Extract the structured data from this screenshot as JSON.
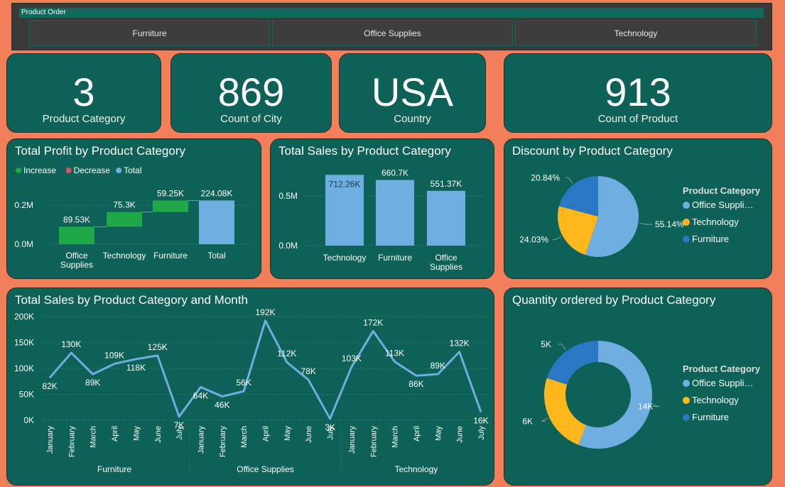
{
  "slicer": {
    "title": "Product Order",
    "options": [
      "Furniture",
      "Office Supplies",
      "Technology"
    ]
  },
  "kpis": [
    {
      "value": "3",
      "label": "Product Category"
    },
    {
      "value": "869",
      "label": "Count of City"
    },
    {
      "value": "USA",
      "label": "Country"
    },
    {
      "value": "913",
      "label": "Count of Product"
    }
  ],
  "colors": {
    "background": "#f07f5a",
    "card": "#0d6157",
    "increase": "#1fa847",
    "decrease": "#e0505a",
    "total": "#6faee0",
    "office_supplies": "#6faee0",
    "technology": "#ffb81c",
    "furniture": "#2a77c4"
  },
  "chart_data": [
    {
      "id": "profit",
      "type": "waterfall",
      "title": "Total Profit by Product Category",
      "legend": [
        {
          "label": "Increase",
          "color": "#1fa847"
        },
        {
          "label": "Decrease",
          "color": "#e0505a"
        },
        {
          "label": "Total",
          "color": "#6faee0"
        }
      ],
      "categories": [
        "Office Supplies",
        "Technology",
        "Furniture",
        "Total"
      ],
      "values": [
        89530,
        75300,
        59250,
        224080
      ],
      "labels": [
        "89.53K",
        "75.3K",
        "59.25K",
        "224.08K"
      ],
      "yticks": [
        "0.0M",
        "0.2M"
      ],
      "ytick_values": [
        0,
        200000
      ],
      "ylim": [
        0,
        260000
      ]
    },
    {
      "id": "sales",
      "type": "bar",
      "title": "Total Sales by Product Category",
      "categories": [
        "Technology",
        "Furniture",
        "Office Supplies"
      ],
      "values": [
        712260,
        660700,
        551370
      ],
      "labels": [
        "712.26K",
        "660.7K",
        "551.37K"
      ],
      "yticks": [
        "0.0M",
        "0.5M"
      ],
      "ytick_values": [
        0,
        500000
      ],
      "ylim": [
        0,
        750000
      ]
    },
    {
      "id": "discount",
      "type": "pie",
      "title": "Discount by Product Category",
      "legend_title": "Product Category",
      "slices": [
        {
          "name": "Office Suppli…",
          "value": 55.14,
          "label": "55.14%",
          "color": "#6faee0"
        },
        {
          "name": "Technology",
          "value": 24.03,
          "label": "24.03%",
          "color": "#ffb81c"
        },
        {
          "name": "Furniture",
          "value": 20.84,
          "label": "20.84%",
          "color": "#2a77c4"
        }
      ]
    },
    {
      "id": "monthly",
      "type": "line",
      "title": "Total Sales by Product Category and Month",
      "groups": [
        "Furniture",
        "Office Supplies",
        "Technology"
      ],
      "months": [
        "January",
        "February",
        "March",
        "April",
        "May",
        "June",
        "July"
      ],
      "values": [
        82,
        130,
        89,
        109,
        118,
        125,
        7,
        64,
        46,
        56,
        192,
        112,
        78,
        3,
        103,
        172,
        113,
        86,
        89,
        132,
        16
      ],
      "labels": [
        "82K",
        "130K",
        "89K",
        "109K",
        "118K",
        "125K",
        "7K",
        "64K",
        "46K",
        "56K",
        "192K",
        "112K",
        "78K",
        "3K",
        "103K",
        "172K",
        "113K",
        "86K",
        "89K",
        "132K",
        "16K"
      ],
      "yticks": [
        "0K",
        "50K",
        "100K",
        "150K",
        "200K"
      ],
      "ytick_values": [
        0,
        50,
        100,
        150,
        200
      ],
      "ylim": [
        0,
        200
      ]
    },
    {
      "id": "quantity",
      "type": "donut",
      "title": "Quantity ordered by Product Category",
      "legend_title": "Product Category",
      "slices": [
        {
          "name": "Office Suppli…",
          "value": 14,
          "label": "14K",
          "color": "#6faee0"
        },
        {
          "name": "Technology",
          "value": 6,
          "label": "6K",
          "color": "#ffb81c"
        },
        {
          "name": "Furniture",
          "value": 5,
          "label": "5K",
          "color": "#2a77c4"
        }
      ]
    }
  ]
}
